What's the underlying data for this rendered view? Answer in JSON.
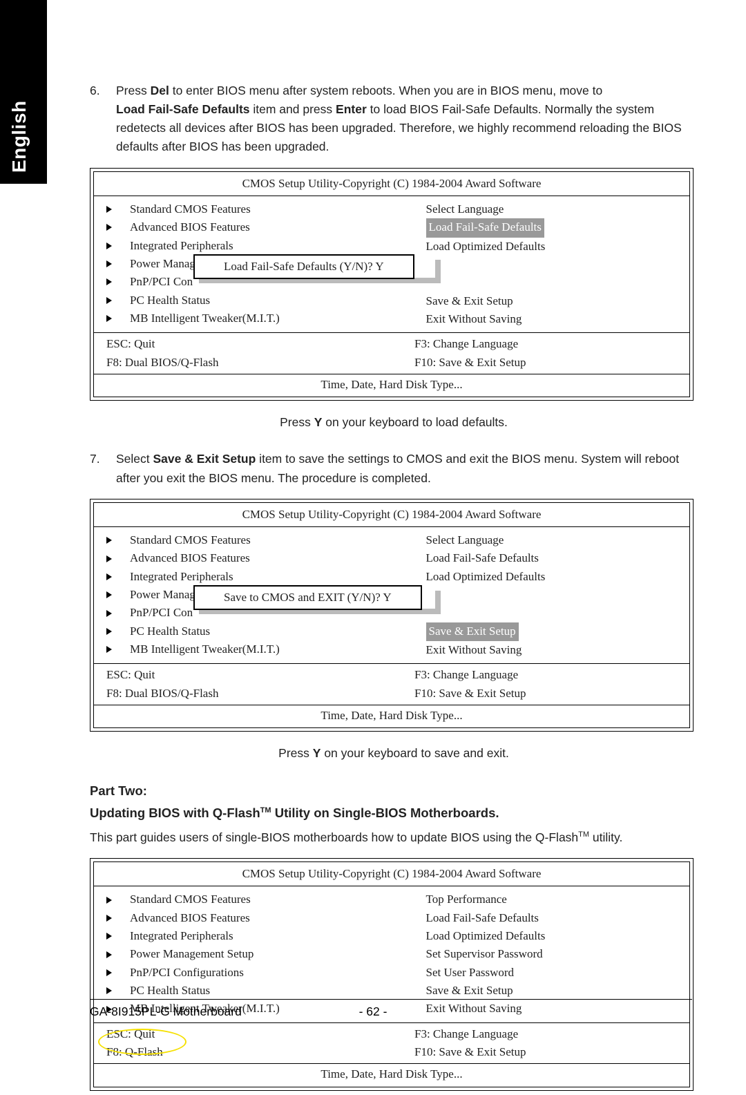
{
  "tab": "English",
  "step6": {
    "n": "6.",
    "line1a": "Press ",
    "del": "Del ",
    "line1b": "to enter BIOS menu after system reboots. When you are in BIOS menu, move to",
    "line2a": "Load Fail-Safe Defaults",
    "line2b": " item and press ",
    "enter": "Enter",
    "line2c": " to load BIOS Fail-Safe Defaults. Normally the system redetects all devices after BIOS has been upgraded. Therefore, we highly recommend reloading the BIOS defaults after BIOS has been upgraded."
  },
  "bios_title": "CMOS Setup Utility-Copyright (C) 1984-2004 Award Software",
  "bios_left": [
    "Standard CMOS Features",
    "Advanced BIOS Features",
    "Integrated Peripherals",
    "Power Manag",
    "PnP/PCI Con",
    "PC Health Status",
    "MB Intelligent Tweaker(M.I.T.)"
  ],
  "bios_left_full": [
    "Standard CMOS Features",
    "Advanced BIOS Features",
    "Integrated Peripherals",
    "Power Management Setup",
    "PnP/PCI Configurations",
    "PC Health Status",
    "MB Intelligent Tweaker(M.I.T.)"
  ],
  "bios_right_a": {
    "r1": "Select Language",
    "r2": "Load Fail-Safe Defaults",
    "r3": "Load Optimized Defaults",
    "r6": "Save & Exit Setup",
    "r7": "Exit Without Saving"
  },
  "bios_right_c": [
    "Top Performance",
    "Load Fail-Safe Defaults",
    "Load Optimized Defaults",
    "Set Supervisor Password",
    "Set User Password",
    "Save & Exit Setup",
    "Exit Without Saving"
  ],
  "popup1": "Load Fail-Safe Defaults (Y/N)? Y",
  "popup2": "Save to CMOS and EXIT (Y/N)? Y",
  "keys_dual": {
    "k1": "ESC: Quit",
    "k2": "F8: Dual BIOS/Q-Flash",
    "k3": "F3: Change Language",
    "k4": "F10: Save & Exit Setup"
  },
  "keys_single": {
    "k1": "ESC: Quit",
    "k2": "F8: Q-Flash",
    "k3": "F3: Change Language",
    "k4": "F10: Save & Exit Setup"
  },
  "bios_help": "Time, Date, Hard Disk Type...",
  "cap1a": "Press ",
  "cap1y": "Y",
  "cap1b": " on your keyboard to load defaults.",
  "step7": {
    "n": "7.",
    "a": "Select ",
    "b": "Save & Exit Setup",
    "c": " item to save the settings to CMOS and exit the BIOS menu. System will reboot after you exit the BIOS menu. The procedure is completed."
  },
  "cap2a": "Press ",
  "cap2y": "Y",
  "cap2b": " on your keyboard to save and exit.",
  "part": "Part Two:",
  "updating_a": "Updating BIOS with Q-Flash",
  "updating_tm": "TM",
  "updating_b": " Utility on Single-BIOS Motherboards.",
  "para3a": "This part guides users of single-BIOS motherboards how to update BIOS using the Q-Flash",
  "para3tm": "TM",
  "para3b": " utility.",
  "footer_model": "GA-8I915PL-G Motherboard",
  "footer_page": "- 62 -"
}
